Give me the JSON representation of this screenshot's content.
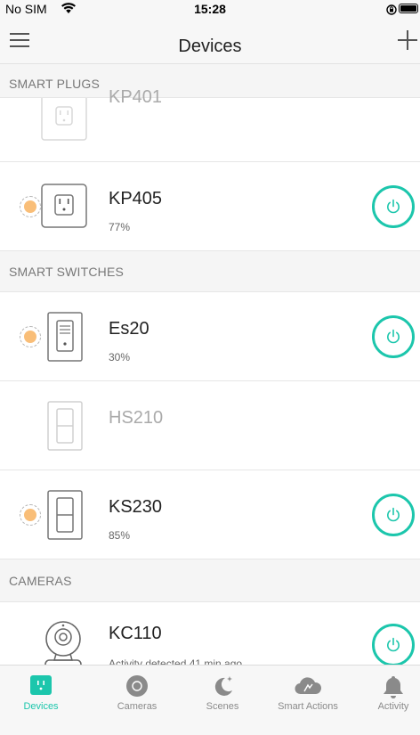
{
  "status_bar": {
    "carrier": "No SIM",
    "time": "15:28",
    "icons": [
      "wifi-icon",
      "rotation-lock-icon",
      "battery-icon"
    ]
  },
  "nav": {
    "title": "Devices",
    "left_icon": "menu-icon",
    "right_icon": "add-icon"
  },
  "sections": {
    "smart_plugs": "SMART PLUGS",
    "smart_switches": "SMART SWITCHES",
    "cameras": "CAMERAS"
  },
  "devices": {
    "kp401": {
      "name": "KP401",
      "icon": "plug-icon",
      "online": false
    },
    "kp405": {
      "name": "KP405",
      "brightness": "77%",
      "icon": "plug-icon",
      "on": true
    },
    "es20": {
      "name": "Es20",
      "brightness": "30%",
      "icon": "dimmer-switch-icon",
      "on": true
    },
    "hs210": {
      "name": "HS210",
      "icon": "switch-icon",
      "online": false
    },
    "ks230": {
      "name": "KS230",
      "brightness": "85%",
      "icon": "switch-icon",
      "on": true
    },
    "kc110": {
      "name": "KC110",
      "status": "Activity detected 41 min ago",
      "icon": "camera-icon",
      "on": true
    }
  },
  "tabs": [
    {
      "label": "Devices",
      "icon": "devices-icon",
      "active": true
    },
    {
      "label": "Cameras",
      "icon": "camera-lens-icon",
      "active": false
    },
    {
      "label": "Scenes",
      "icon": "moon-icon",
      "active": false
    },
    {
      "label": "Smart Actions",
      "icon": "cloud-icon",
      "active": false
    },
    {
      "label": "Activity",
      "icon": "bell-icon",
      "active": false
    }
  ],
  "colors": {
    "accent": "#1cc6ac",
    "status_dot": "#f9be78",
    "section_bg": "#f5f5f5",
    "bar_bg": "#f7f7f7"
  }
}
